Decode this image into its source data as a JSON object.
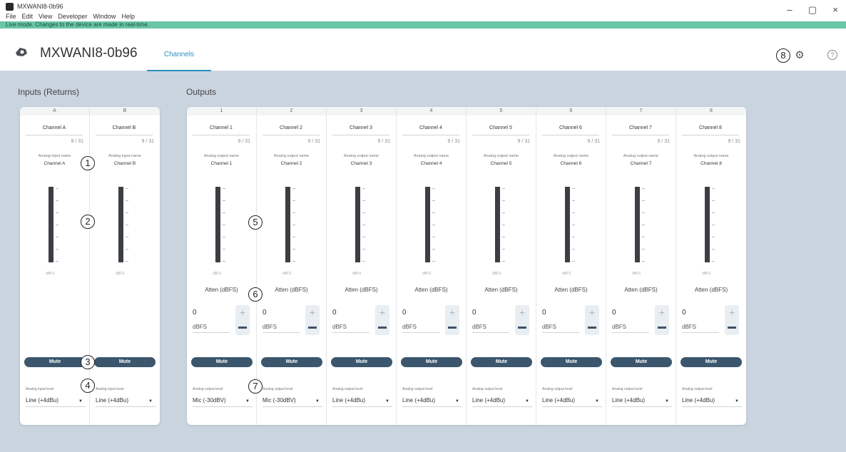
{
  "window": {
    "title": "MXWANI8-0b96",
    "menu": [
      "File",
      "Edit",
      "View",
      "Developer",
      "Window",
      "Help"
    ],
    "controls": {
      "minimize": "–",
      "maximize": "▢",
      "close": "×"
    }
  },
  "live_banner": "Live mode. Changes to the device are made in real-time.",
  "header": {
    "device_name": "MXWANI8-0b96",
    "tab": "Channels",
    "icons": [
      "device-icon",
      "gear-icon",
      "help-icon"
    ]
  },
  "inputs": {
    "title": "Inputs (Returns)",
    "columns": [
      {
        "header": "A",
        "name": "Channel A",
        "count": "9 / 31",
        "type_label": "Analog input name",
        "sub_name": "Channel A",
        "meter_label": "dBFS",
        "mute": "Mute",
        "level_label": "Analog input level",
        "level": "Line (+4dBu)"
      },
      {
        "header": "B",
        "name": "Channel B",
        "count": "9 / 31",
        "type_label": "Analog input name",
        "sub_name": "Channel B",
        "meter_label": "dBFS",
        "mute": "Mute",
        "level_label": "Analog input level",
        "level": "Line (+4dBu)"
      }
    ]
  },
  "outputs": {
    "title": "Outputs",
    "columns": [
      {
        "header": "1",
        "name": "Channel 1",
        "count": "9 / 31",
        "type_label": "Analog output name",
        "sub_name": "Channel 1",
        "meter_label": "dBFS",
        "atten_label": "Atten (dBFS)",
        "atten_value": "0",
        "atten_unit": "dBFS",
        "mute": "Mute",
        "level_label": "Analog output level",
        "level": "Mic (-30dBV)"
      },
      {
        "header": "2",
        "name": "Channel 2",
        "count": "9 / 31",
        "type_label": "Analog output name",
        "sub_name": "Channel 2",
        "meter_label": "dBFS",
        "atten_label": "Atten (dBFS)",
        "atten_value": "0",
        "atten_unit": "dBFS",
        "mute": "Mute",
        "level_label": "Analog output level",
        "level": "Mic (-30dBV)"
      },
      {
        "header": "3",
        "name": "Channel 3",
        "count": "9 / 31",
        "type_label": "Analog output name",
        "sub_name": "Channel 3",
        "meter_label": "dBFS",
        "atten_label": "Atten (dBFS)",
        "atten_value": "0",
        "atten_unit": "dBFS",
        "mute": "Mute",
        "level_label": "Analog output level",
        "level": "Line (+4dBu)"
      },
      {
        "header": "4",
        "name": "Channel 4",
        "count": "9 / 31",
        "type_label": "Analog output name",
        "sub_name": "Channel 4",
        "meter_label": "dBFS",
        "atten_label": "Atten (dBFS)",
        "atten_value": "0",
        "atten_unit": "dBFS",
        "mute": "Mute",
        "level_label": "Analog output level",
        "level": "Line (+4dBu)"
      },
      {
        "header": "5",
        "name": "Channel 5",
        "count": "9 / 31",
        "type_label": "Analog output name",
        "sub_name": "Channel 5",
        "meter_label": "dBFS",
        "atten_label": "Atten (dBFS)",
        "atten_value": "0",
        "atten_unit": "dBFS",
        "mute": "Mute",
        "level_label": "Analog output level",
        "level": "Line (+4dBu)"
      },
      {
        "header": "6",
        "name": "Channel 6",
        "count": "9 / 31",
        "type_label": "Analog output name",
        "sub_name": "Channel 6",
        "meter_label": "dBFS",
        "atten_label": "Atten (dBFS)",
        "atten_value": "0",
        "atten_unit": "dBFS",
        "mute": "Mute",
        "level_label": "Analog output level",
        "level": "Line (+4dBu)"
      },
      {
        "header": "7",
        "name": "Channel 7",
        "count": "9 / 31",
        "type_label": "Analog output name",
        "sub_name": "Channel 7",
        "meter_label": "dBFS",
        "atten_label": "Atten (dBFS)",
        "atten_value": "0",
        "atten_unit": "dBFS",
        "mute": "Mute",
        "level_label": "Analog output level",
        "level": "Line (+4dBu)"
      },
      {
        "header": "8",
        "name": "Channel 8",
        "count": "9 / 31",
        "type_label": "Analog output name",
        "sub_name": "Channel 8",
        "meter_label": "dBFS",
        "atten_label": "Atten (dBFS)",
        "atten_value": "0",
        "atten_unit": "dBFS",
        "mute": "Mute",
        "level_label": "Analog output level",
        "level": "Line (+4dBu)"
      }
    ]
  },
  "callouts": [
    "1",
    "2",
    "3",
    "4",
    "5",
    "6",
    "7",
    "8"
  ],
  "colors": {
    "live_banner": "#69c6a8",
    "tab_accent": "#2b8fbf",
    "mute": "#3b566d",
    "meter": "#3b3f43",
    "background": "#c9d4df"
  }
}
